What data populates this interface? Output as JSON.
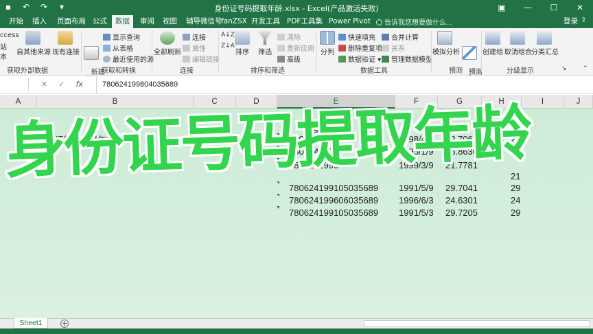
{
  "titlebar": {
    "title": "身份证号码提取年龄.xlsx - Excel(产品激活失败)",
    "qat_icons": [
      "save-icon",
      "undo-icon",
      "redo-icon",
      "qat-customize-icon"
    ],
    "controls": [
      "restore-ribbon-icon",
      "minimize-icon",
      "maximize-icon",
      "close-icon"
    ]
  },
  "tabs": [
    {
      "label": "开始"
    },
    {
      "label": "插入"
    },
    {
      "label": "页面布局"
    },
    {
      "label": "公式"
    },
    {
      "label": "数据",
      "active": true
    },
    {
      "label": "审阅"
    },
    {
      "label": "视图"
    },
    {
      "label": "辅导微信号"
    },
    {
      "label": "fanZSX"
    },
    {
      "label": "开发工具"
    },
    {
      "label": "PDF工具集"
    },
    {
      "label": "Power Pivot"
    }
  ],
  "tell_me": "告诉我您想要做什么...",
  "login": "登录",
  "ribbon": {
    "get_external": {
      "access": "ccess",
      "web": "站",
      "text": "本",
      "other": "自其他来源",
      "existing": "现有连接",
      "label": "获取外部数据"
    },
    "get_transform": {
      "new_query": "新建\n查询",
      "show_queries": "显示查询",
      "from_table": "从表格",
      "recent": "最近使用的源",
      "label": "获取和转换"
    },
    "connections": {
      "refresh_all": "全部刷新",
      "connections": "连接",
      "properties": "属性",
      "edit_links": "编辑链接",
      "label": "连接"
    },
    "sort_filter": {
      "sort": "排序",
      "filter": "筛选",
      "clear": "清除",
      "reapply": "重新应用",
      "advanced": "高级",
      "label": "排序和筛选"
    },
    "data_tools": {
      "split": "分列",
      "flash_fill": "快速填充",
      "remove_dup": "删除重复项",
      "validation": "数据验证",
      "consolidate": "合并计算",
      "relations": "关系",
      "data_model": "管理数据模型",
      "label": "数据工具"
    },
    "forecast": {
      "what_if": "模拟分析",
      "sheet": "预测\n工作表",
      "label": "预测"
    },
    "outline": {
      "group": "创建组",
      "ungroup": "取消组合",
      "subtotal": "分类汇总",
      "label": "分级显示"
    }
  },
  "formula_bar": {
    "name_box": "",
    "fx": "fx",
    "value": "780624199804035689"
  },
  "columns": [
    "A",
    "B",
    "C",
    "D",
    "E",
    "F",
    "G",
    "H",
    "I",
    "J"
  ],
  "selected_column": "E",
  "sheet_cells": {
    "b_note": "身份证第七位是年龄",
    "e_header": "身份证",
    "rows": [
      {
        "id": "7806241998",
        "date": "1998/4/3",
        "age_exact": "22.7068",
        "age": "22"
      },
      {
        "id": "7806241995",
        "date": "1995/1/9",
        "age_exact": "25.8630",
        "age": "25"
      },
      {
        "id": "7806241999",
        "date": "1999/3/9",
        "age_exact": "21.7781",
        "age": "21"
      },
      {
        "id": "780624199105035689",
        "date": "1991/5/9",
        "age_exact": "29.7041",
        "age": "29"
      },
      {
        "id": "780624199606035689",
        "date": "1996/6/3",
        "age_exact": "24.6301",
        "age": "24"
      },
      {
        "id": "780624199105035689",
        "date": "1991/5/3",
        "age_exact": "29.7205",
        "age": "29"
      }
    ]
  },
  "overlay_title": "身份证号码提取年龄",
  "sheet_tab": "Sheet1",
  "colors": {
    "excel_green": "#217346",
    "overlay_green": "#33d54f",
    "sheet_tint": "#d3eedc"
  }
}
